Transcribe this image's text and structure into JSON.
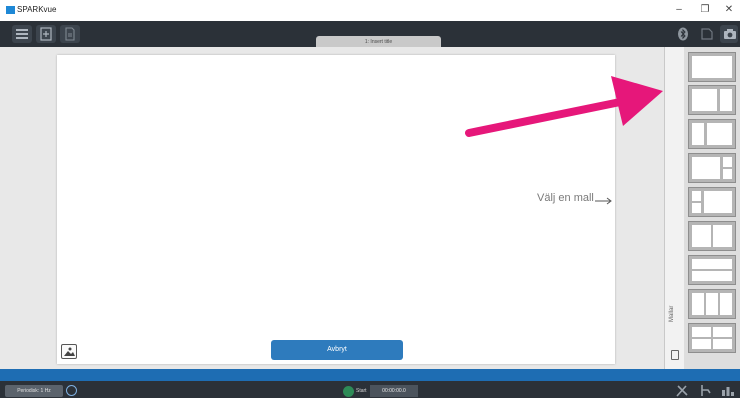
{
  "window": {
    "title": "SPARKvue",
    "minimize_glyph": "–",
    "restore_glyph": "❐",
    "close_glyph": "✕"
  },
  "toolbar": {
    "menu_icon": "hamburger-icon",
    "add_page_icon": "add-page-icon",
    "page_icon": "page-icon",
    "bluetooth_icon": "bluetooth-icon",
    "journal_icon": "journal-icon",
    "camera_icon": "camera-icon"
  },
  "page_tab": {
    "label": "1: Insert title"
  },
  "canvas": {
    "hint_label": "Välj en mall",
    "cancel_label": "Avbryt",
    "image_icon": "image-icon"
  },
  "drawer": {
    "label": "Mallar"
  },
  "templates": [
    "single",
    "two-columns-wide-left",
    "two-columns-narrow-left",
    "wide-left-two-right",
    "two-left-wide-right",
    "two-columns-equal",
    "two-rows",
    "three-columns",
    "two-by-two-grid"
  ],
  "annotation": {
    "color": "#e6177a",
    "icon": "pink-arrow"
  },
  "bottom": {
    "rate_label": "Periodisk: 1 Hz",
    "start_label": "Start",
    "timer_value": "00:00:00.0",
    "tools_icon": "tools-icon",
    "sensor_icon": "sensor-icon",
    "data_icon": "data-icon"
  },
  "colors": {
    "toolbar": "#2b3138",
    "accent": "#2e7bbd",
    "strip": "#1e6db3",
    "workspace": "#e8e8e8"
  }
}
